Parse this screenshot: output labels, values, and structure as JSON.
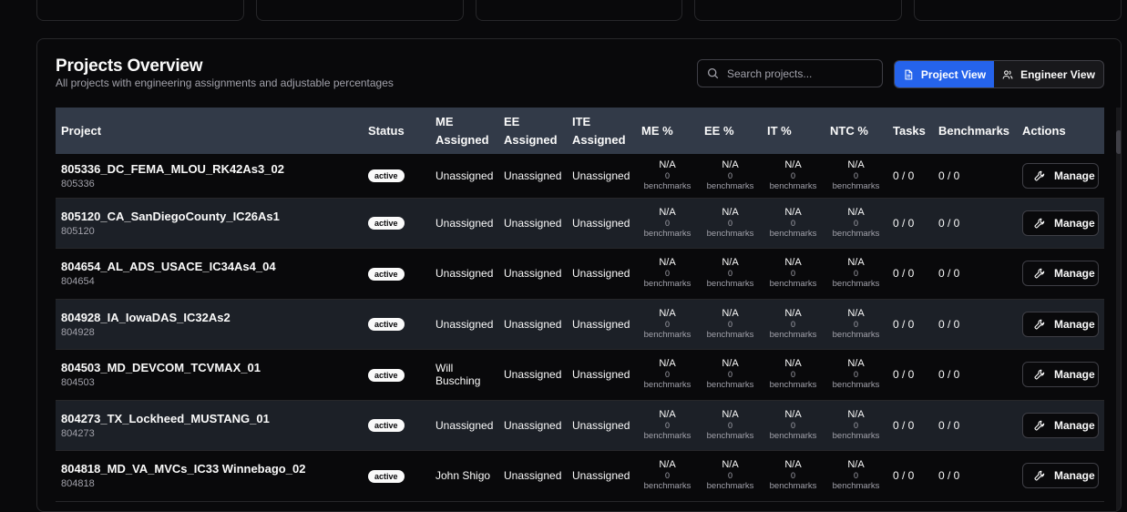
{
  "header": {
    "title": "Projects Overview",
    "subtitle": "All projects with engineering assignments and adjustable percentages"
  },
  "search": {
    "placeholder": "Search projects...",
    "value": ""
  },
  "view_toggle": {
    "project_view": "Project View",
    "engineer_view": "Engineer View",
    "active": "Project View"
  },
  "table": {
    "headers": {
      "project": "Project",
      "status": "Status",
      "me_assigned": "ME Assigned",
      "ee_assigned": "EE Assigned",
      "ite_assigned": "ITE Assigned",
      "me_pct": "ME %",
      "ee_pct": "EE %",
      "it_pct": "IT %",
      "ntc_pct": "NTC %",
      "tasks": "Tasks",
      "benchmarks": "Benchmarks",
      "actions": "Actions"
    },
    "pct_placeholder": {
      "value": "N/A",
      "count": "0",
      "label": "benchmarks"
    },
    "manage_label": "Manage",
    "rows": [
      {
        "name": "805336_DC_FEMA_MLOU_RK42As3_02",
        "id": "805336",
        "status": "active",
        "me": "Unassigned",
        "ee": "Unassigned",
        "ite": "Unassigned",
        "tasks": "0 / 0",
        "benchmarks": "0 / 0"
      },
      {
        "name": "805120_CA_SanDiegoCounty_IC26As1",
        "id": "805120",
        "status": "active",
        "me": "Unassigned",
        "ee": "Unassigned",
        "ite": "Unassigned",
        "tasks": "0 / 0",
        "benchmarks": "0 / 0"
      },
      {
        "name": "804654_AL_ADS_USACE_IC34As4_04",
        "id": "804654",
        "status": "active",
        "me": "Unassigned",
        "ee": "Unassigned",
        "ite": "Unassigned",
        "tasks": "0 / 0",
        "benchmarks": "0 / 0"
      },
      {
        "name": "804928_IA_IowaDAS_IC32As2",
        "id": "804928",
        "status": "active",
        "me": "Unassigned",
        "ee": "Unassigned",
        "ite": "Unassigned",
        "tasks": "0 / 0",
        "benchmarks": "0 / 0"
      },
      {
        "name": "804503_MD_DEVCOM_TCVMAX_01",
        "id": "804503",
        "status": "active",
        "me": "Will Busching",
        "ee": "Unassigned",
        "ite": "Unassigned",
        "tasks": "0 / 0",
        "benchmarks": "0 / 0"
      },
      {
        "name": "804273_TX_Lockheed_MUSTANG_01",
        "id": "804273",
        "status": "active",
        "me": "Unassigned",
        "ee": "Unassigned",
        "ite": "Unassigned",
        "tasks": "0 / 0",
        "benchmarks": "0 / 0"
      },
      {
        "name": "804818_MD_VA_MVCs_IC33 Winnebago_02",
        "id": "804818",
        "status": "active",
        "me": "John Shigo",
        "ee": "Unassigned",
        "ite": "Unassigned",
        "tasks": "0 / 0",
        "benchmarks": "0 / 0"
      }
    ]
  }
}
